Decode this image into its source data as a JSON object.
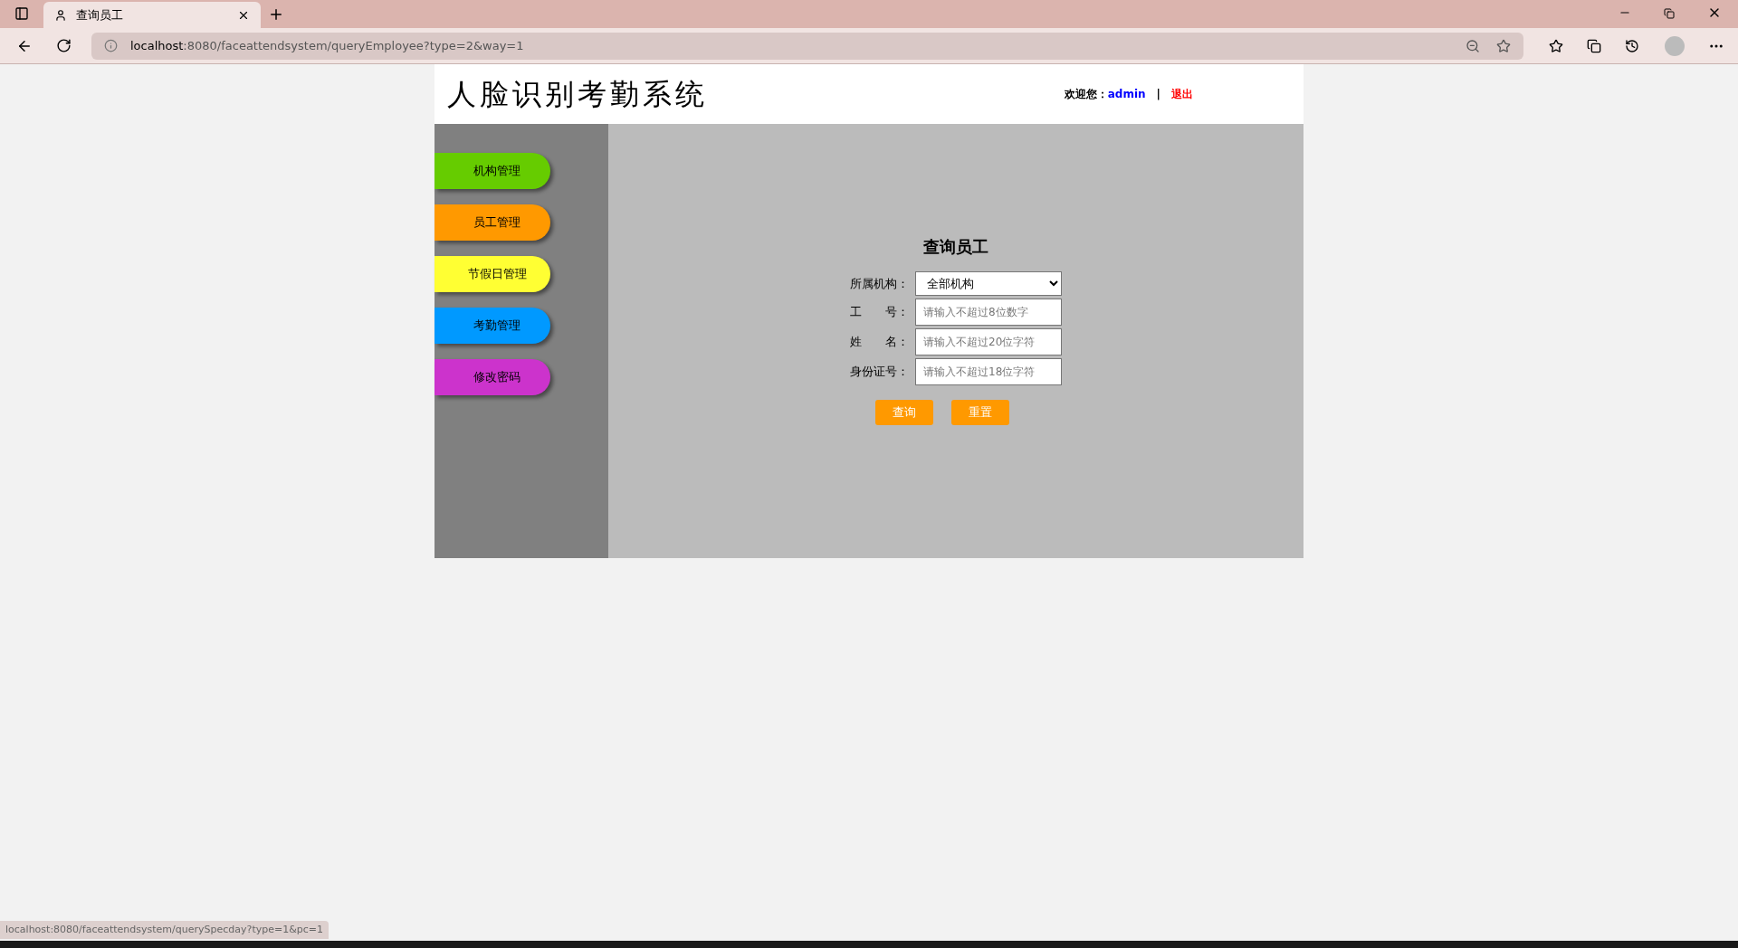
{
  "browser": {
    "tab_title": "查询员工",
    "url_host": "localhost",
    "url_rest": ":8080/faceattendsystem/queryEmployee?type=2&way=1",
    "status_url": "localhost:8080/faceattendsystem/querySpecday?type=1&pc=1"
  },
  "header": {
    "title": "人脸识别考勤系统",
    "welcome": "欢迎您：",
    "user": "admin",
    "separator": "|",
    "logout": "退出"
  },
  "sidebar": {
    "items": [
      {
        "label": "机构管理",
        "color": "#66cc00"
      },
      {
        "label": "员工管理",
        "color": "#ff9900"
      },
      {
        "label": "节假日管理",
        "color": "#ffff33"
      },
      {
        "label": "考勤管理",
        "color": "#0099ff"
      },
      {
        "label": "修改密码",
        "color": "#cc33cc"
      }
    ]
  },
  "form": {
    "title": "查询员工",
    "fields": [
      {
        "kind": "select",
        "label": "所属机构：",
        "value": "全部机构"
      },
      {
        "kind": "text",
        "label": "工　　号：",
        "placeholder": "请输入不超过8位数字"
      },
      {
        "kind": "text",
        "label": "姓　　名：",
        "placeholder": "请输入不超过20位字符"
      },
      {
        "kind": "text",
        "label": "身份证号：",
        "placeholder": "请输入不超过18位字符"
      }
    ],
    "buttons": [
      "查询",
      "重置"
    ]
  }
}
